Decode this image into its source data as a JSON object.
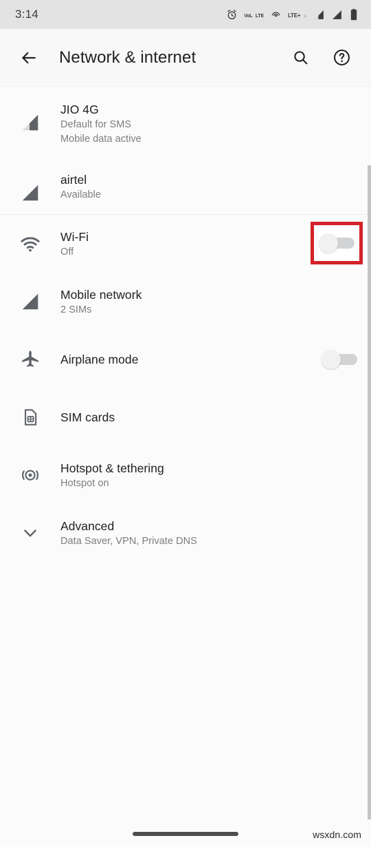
{
  "status_bar": {
    "time": "3:14",
    "icons": [
      {
        "name": "alarm-icon",
        "label": "alarm"
      },
      {
        "name": "volte-icon",
        "label": "VoLTE",
        "line1": "VoL",
        "line2": "LTE"
      },
      {
        "name": "hotspot-icon",
        "label": "hotspot"
      },
      {
        "name": "lte-plus-icon",
        "label": "LTE+",
        "line1": "LTE+",
        "line2": "11"
      },
      {
        "name": "signal-bars-sim1-icon",
        "label": "signal sim 1"
      },
      {
        "name": "signal-bars-sim2-icon",
        "label": "signal sim 2"
      },
      {
        "name": "battery-icon",
        "label": "battery"
      }
    ]
  },
  "app_bar": {
    "title": "Network & internet",
    "back_icon": "arrow-back-icon",
    "search_icon": "search-icon",
    "help_icon": "help-circle-icon"
  },
  "sim_section": [
    {
      "icon": "signal-bars-partial-icon",
      "title": "JIO 4G",
      "sub1": "Default for SMS",
      "sub2": "Mobile data active"
    },
    {
      "icon": "signal-bars-full-icon",
      "title": "airtel",
      "sub1": "Available",
      "sub2": ""
    }
  ],
  "settings_rows": [
    {
      "key": "wifi",
      "icon": "wifi-icon",
      "title": "Wi-Fi",
      "sub": "Off",
      "toggle": {
        "present": true,
        "state": "off",
        "highlighted": true
      }
    },
    {
      "key": "mobile_network",
      "icon": "signal-bars-full-icon",
      "title": "Mobile network",
      "sub": "2 SIMs",
      "toggle": {
        "present": false,
        "state": "",
        "highlighted": false
      }
    },
    {
      "key": "airplane_mode",
      "icon": "airplane-icon",
      "title": "Airplane mode",
      "sub": "",
      "toggle": {
        "present": true,
        "state": "off",
        "highlighted": false
      }
    },
    {
      "key": "sim_cards",
      "icon": "sim-card-icon",
      "title": "SIM cards",
      "sub": "",
      "toggle": {
        "present": false,
        "state": "",
        "highlighted": false
      }
    },
    {
      "key": "hotspot_tethering",
      "icon": "hotspot-icon",
      "title": "Hotspot & tethering",
      "sub": "Hotspot on",
      "toggle": {
        "present": false,
        "state": "",
        "highlighted": false
      }
    },
    {
      "key": "advanced",
      "icon": "chevron-down-icon",
      "title": "Advanced",
      "sub": "Data Saver, VPN, Private DNS",
      "toggle": {
        "present": false,
        "state": "",
        "highlighted": false
      }
    }
  ],
  "annotation": {
    "target": "wifi-toggle",
    "color": "#d32229"
  },
  "footer": {
    "watermark": "wsxdn.com"
  },
  "colors": {
    "status_bar_bg": "#e3e3e3",
    "app_bar_bg": "#f8f8f8",
    "page_bg": "#fbfbfb",
    "title_text": "#202124",
    "sub_text": "#7a7d80",
    "icon_gray": "#5f6368",
    "toggle_track_off": "#d2d3d5",
    "toggle_knob_off": "#f1f1f1",
    "highlight_red": "#d32229"
  }
}
